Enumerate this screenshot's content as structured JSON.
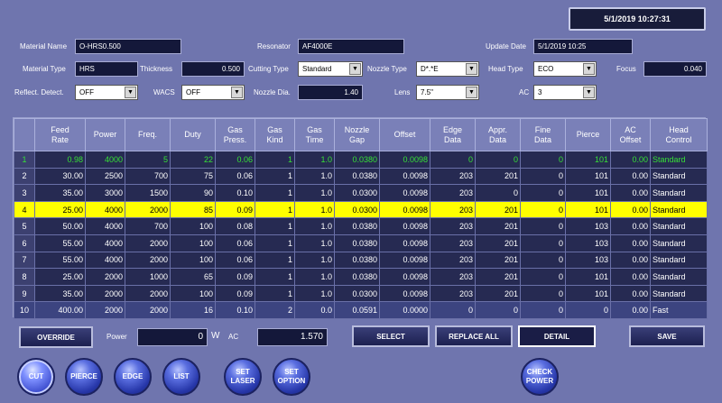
{
  "datetime": "5/1/2019 10:27:31",
  "fields": {
    "material_name": {
      "label": "Material Name",
      "value": "O-HRS0.500"
    },
    "resonator": {
      "label": "Resonator",
      "value": "AF4000E"
    },
    "update_date": {
      "label": "Update Date",
      "value": "5/1/2019 10:25"
    },
    "material_type": {
      "label": "Material Type",
      "value": "HRS"
    },
    "thickness": {
      "label": "Thickness",
      "value": "0.500"
    },
    "cutting_type": {
      "label": "Cutting Type",
      "value": "Standard"
    },
    "nozzle_type": {
      "label": "Nozzle Type",
      "value": "D*.*E"
    },
    "head_type": {
      "label": "Head Type",
      "value": "ECO"
    },
    "focus": {
      "label": "Focus",
      "value": "0.040"
    },
    "reflect_detect": {
      "label": "Reflect. Detect.",
      "value": "OFF"
    },
    "wacs": {
      "label": "WACS",
      "value": "OFF"
    },
    "nozzle_dia": {
      "label": "Nozzle Dia.",
      "value": "1.40"
    },
    "lens": {
      "label": "Lens",
      "value": "7.5\""
    },
    "ac": {
      "label": "AC",
      "value": "3"
    }
  },
  "table": {
    "headers": [
      {
        "l1": "",
        "l2": ""
      },
      {
        "l1": "Feed",
        "l2": "Rate"
      },
      {
        "l1": "Power",
        "l2": ""
      },
      {
        "l1": "Freq.",
        "l2": ""
      },
      {
        "l1": "Duty",
        "l2": ""
      },
      {
        "l1": "Gas",
        "l2": "Press."
      },
      {
        "l1": "Gas",
        "l2": "Kind"
      },
      {
        "l1": "Gas",
        "l2": "Time"
      },
      {
        "l1": "Nozzle",
        "l2": "Gap"
      },
      {
        "l1": "Offset",
        "l2": ""
      },
      {
        "l1": "Edge",
        "l2": "Data"
      },
      {
        "l1": "Appr.",
        "l2": "Data"
      },
      {
        "l1": "Fine",
        "l2": "Data"
      },
      {
        "l1": "Pierce",
        "l2": ""
      },
      {
        "l1": "AC",
        "l2": "Offset"
      },
      {
        "l1": "Head",
        "l2": "Control"
      }
    ],
    "rows": [
      [
        "1",
        "0.98",
        "4000",
        "5",
        "22",
        "0.06",
        "1",
        "1.0",
        "0.0380",
        "0.0098",
        "0",
        "0",
        "0",
        "101",
        "0.00",
        "Standard"
      ],
      [
        "2",
        "30.00",
        "2500",
        "700",
        "75",
        "0.06",
        "1",
        "1.0",
        "0.0380",
        "0.0098",
        "203",
        "201",
        "0",
        "101",
        "0.00",
        "Standard"
      ],
      [
        "3",
        "35.00",
        "3000",
        "1500",
        "90",
        "0.10",
        "1",
        "1.0",
        "0.0300",
        "0.0098",
        "203",
        "0",
        "0",
        "101",
        "0.00",
        "Standard"
      ],
      [
        "4",
        "25.00",
        "4000",
        "2000",
        "85",
        "0.09",
        "1",
        "1.0",
        "0.0300",
        "0.0098",
        "203",
        "201",
        "0",
        "101",
        "0.00",
        "Standard"
      ],
      [
        "5",
        "50.00",
        "4000",
        "700",
        "100",
        "0.08",
        "1",
        "1.0",
        "0.0380",
        "0.0098",
        "203",
        "201",
        "0",
        "103",
        "0.00",
        "Standard"
      ],
      [
        "6",
        "55.00",
        "4000",
        "2000",
        "100",
        "0.06",
        "1",
        "1.0",
        "0.0380",
        "0.0098",
        "203",
        "201",
        "0",
        "103",
        "0.00",
        "Standard"
      ],
      [
        "7",
        "55.00",
        "4000",
        "2000",
        "100",
        "0.06",
        "1",
        "1.0",
        "0.0380",
        "0.0098",
        "203",
        "201",
        "0",
        "103",
        "0.00",
        "Standard"
      ],
      [
        "8",
        "25.00",
        "2000",
        "1000",
        "65",
        "0.09",
        "1",
        "1.0",
        "0.0380",
        "0.0098",
        "203",
        "201",
        "0",
        "101",
        "0.00",
        "Standard"
      ],
      [
        "9",
        "35.00",
        "2000",
        "2000",
        "100",
        "0.09",
        "1",
        "1.0",
        "0.0300",
        "0.0098",
        "203",
        "201",
        "0",
        "101",
        "0.00",
        "Standard"
      ],
      [
        "10",
        "400.00",
        "2000",
        "2000",
        "16",
        "0.10",
        "2",
        "0.0",
        "0.0591",
        "0.0000",
        "0",
        "0",
        "0",
        "0",
        "0.00",
        "Fast"
      ]
    ]
  },
  "controls": {
    "override": "OVERRIDE",
    "power_label": "Power",
    "power_value": "0",
    "power_unit": "W",
    "ac_label": "AC",
    "ac_value": "1.570",
    "select": "SELECT",
    "replace_all": "REPLACE ALL",
    "detail": "DETAIL",
    "save": "SAVE"
  },
  "circle_buttons": {
    "cut": "CUT",
    "pierce": "PIERCE",
    "edge": "EDGE",
    "list": "LIST",
    "set_laser_1": "SET",
    "set_laser_2": "LASER",
    "set_option_1": "SET",
    "set_option_2": "OPTION",
    "check_power_1": "CHECK",
    "check_power_2": "POWER"
  }
}
